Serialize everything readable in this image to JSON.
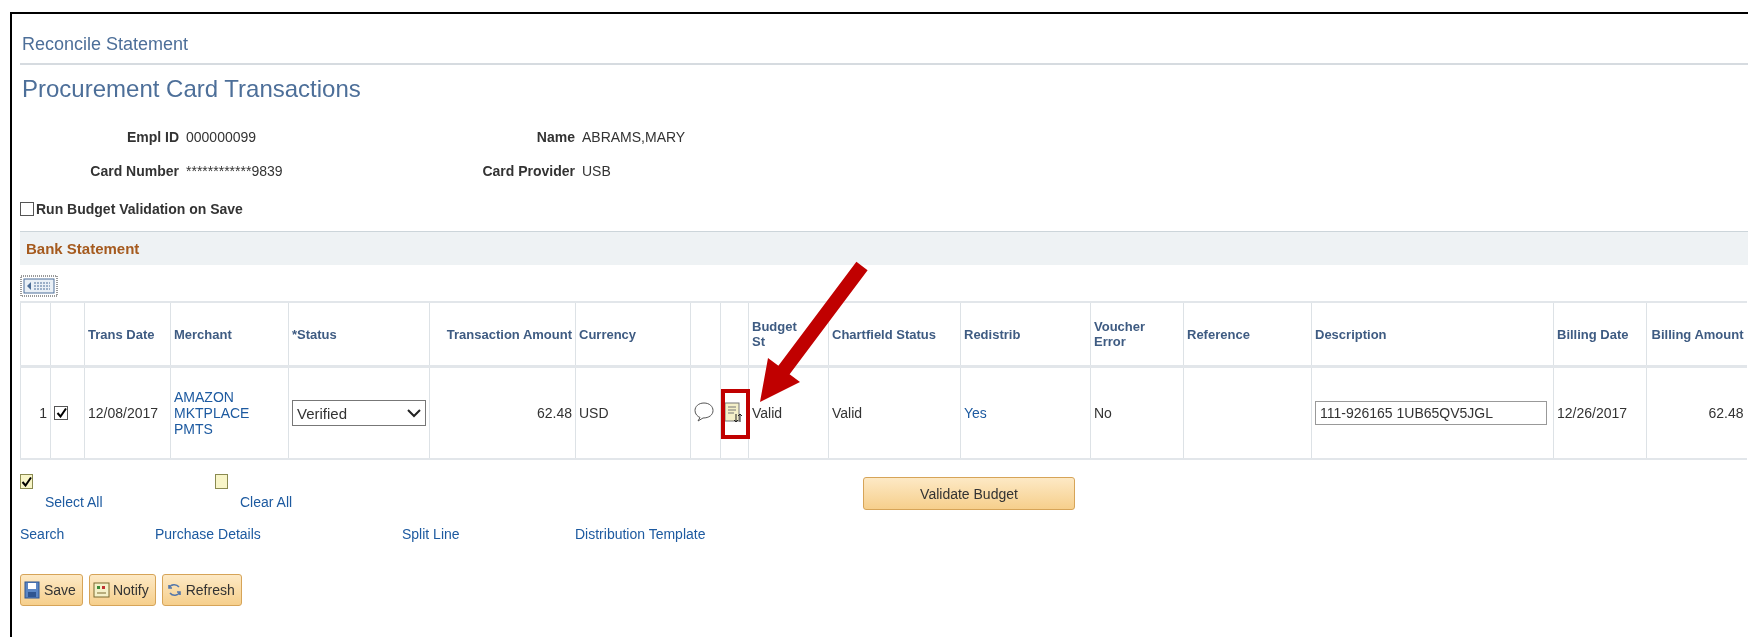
{
  "breadcrumb": "Reconcile Statement",
  "page_title": "Procurement Card Transactions",
  "fields": [
    {
      "label": "Empl ID",
      "value": "000000099"
    },
    {
      "label": "Name",
      "value": "ABRAMS,MARY"
    },
    {
      "label": "Card Number",
      "value": "************9839"
    },
    {
      "label": "Card Provider",
      "value": "USB"
    }
  ],
  "run_budget_validation": {
    "label": "Run Budget Validation on Save",
    "checked": false
  },
  "section": {
    "title": "Bank Statement"
  },
  "table": {
    "columns": [
      {
        "kind": "number"
      },
      {
        "kind": "select"
      },
      {
        "kind": "text",
        "label": "Trans Date"
      },
      {
        "kind": "text",
        "label": "Merchant"
      },
      {
        "kind": "text",
        "label": "*Status"
      },
      {
        "kind": "amount",
        "label": "Transaction Amount"
      },
      {
        "kind": "text",
        "label": "Currency"
      },
      {
        "kind": "icon"
      },
      {
        "kind": "icon"
      },
      {
        "kind": "text",
        "label": "Budget St"
      },
      {
        "kind": "text",
        "label": "Chartfield Status"
      },
      {
        "kind": "text",
        "label": "Redistrib"
      },
      {
        "kind": "text",
        "label": "Voucher Error"
      },
      {
        "kind": "text",
        "label": "Reference"
      },
      {
        "kind": "text",
        "label": "Description"
      },
      {
        "kind": "text",
        "label": "Billing Date"
      },
      {
        "kind": "amount",
        "label": "Billing Amount"
      }
    ],
    "rows": [
      {
        "cells": [
          {
            "kind": "text",
            "text": "1"
          },
          {
            "kind": "checkbox",
            "checked": true
          },
          {
            "kind": "text",
            "text": "12/08/2017"
          },
          {
            "kind": "link",
            "text": "AMAZON MKTPLACE PMTS"
          },
          {
            "kind": "dropdown",
            "value": "Verified"
          },
          {
            "kind": "text",
            "text": "62.48"
          },
          {
            "kind": "text",
            "text": "USD"
          },
          {
            "kind": "comment"
          },
          {
            "kind": "details",
            "highlighted": true
          },
          {
            "kind": "text",
            "text": "Valid"
          },
          {
            "kind": "text",
            "text": "Valid"
          },
          {
            "kind": "link",
            "text": "Yes"
          },
          {
            "kind": "text",
            "text": "No"
          },
          {
            "kind": "empty"
          },
          {
            "kind": "input",
            "value": "111-926165 1UB65QV5JGL"
          },
          {
            "kind": "text",
            "text": "12/26/2017"
          },
          {
            "kind": "text",
            "text": "62.48"
          }
        ]
      }
    ]
  },
  "select_all": {
    "label": "Select All",
    "checked": true
  },
  "clear_all": {
    "label": "Clear All",
    "checked": false
  },
  "validate_button": "Validate Budget",
  "links": [
    "Search",
    "Purchase Details",
    "Split Line",
    "Distribution Template"
  ],
  "buttons": [
    {
      "kind": "save",
      "label": "Save"
    },
    {
      "kind": "notify",
      "label": "Notify"
    },
    {
      "kind": "refresh",
      "label": "Refresh"
    }
  ]
}
